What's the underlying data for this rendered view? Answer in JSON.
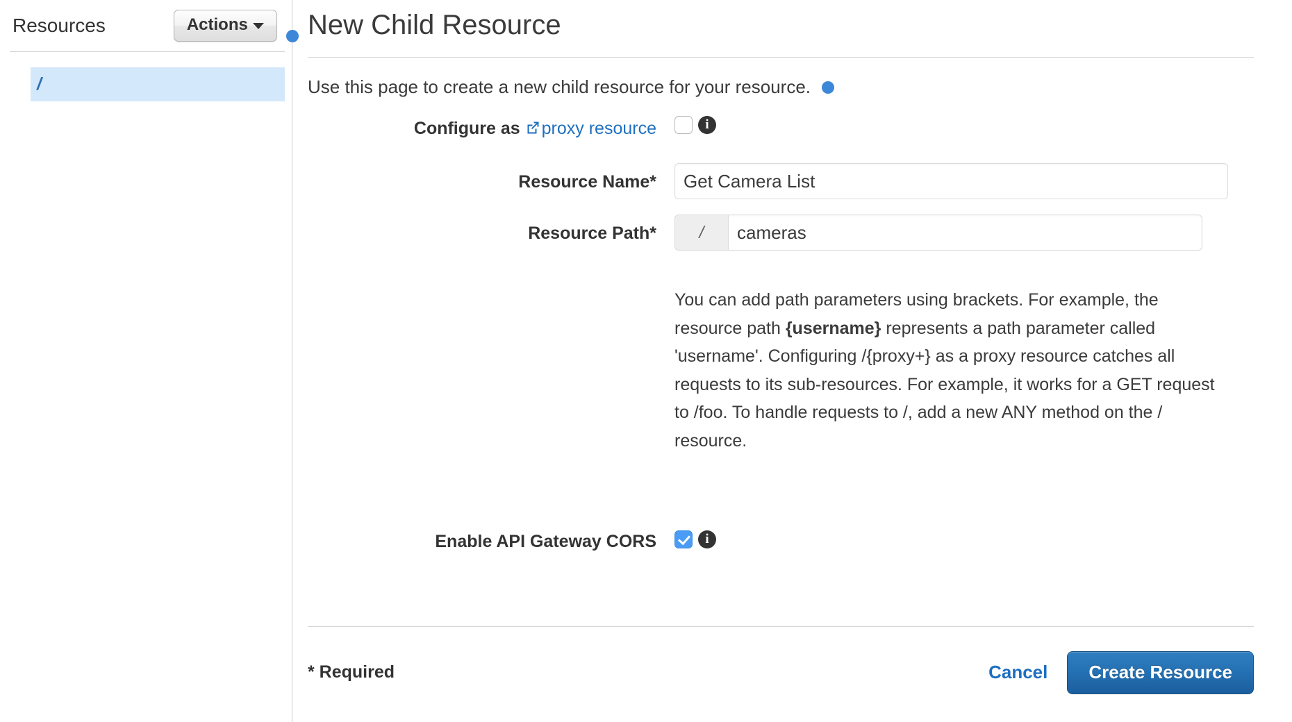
{
  "sidebar": {
    "title": "Resources",
    "actions_button": "Actions",
    "tree": [
      {
        "label": "/",
        "selected": true
      }
    ]
  },
  "main": {
    "page_title": "New Child Resource",
    "intro_text": "Use this page to create a new child resource for your resource.",
    "marker_color": "#3d87d8",
    "form": {
      "proxy": {
        "label_prefix": "Configure as",
        "link_text": "proxy resource",
        "checked": false,
        "info_tooltip": "i"
      },
      "resource_name": {
        "label": "Resource Name*",
        "value": "Get Camera List",
        "placeholder": ""
      },
      "resource_path": {
        "label": "Resource Path*",
        "prefix": "/",
        "value": "cameras",
        "placeholder": ""
      },
      "help_text_part1": "You can add path parameters using brackets. For example, the resource path ",
      "help_text_bold": "{username}",
      "help_text_part2": " represents a path parameter called 'username'. Configuring /{proxy+} as a proxy resource catches all requests to its sub-resources. For example, it works for a GET request to /foo. To handle requests to /, add a new ANY method on the / resource.",
      "cors": {
        "label": "Enable API Gateway CORS",
        "checked": true,
        "info_tooltip": "i"
      }
    },
    "footer": {
      "required_note": "* Required",
      "cancel_label": "Cancel",
      "create_label": "Create Resource",
      "create_color": "#2470b2"
    }
  }
}
